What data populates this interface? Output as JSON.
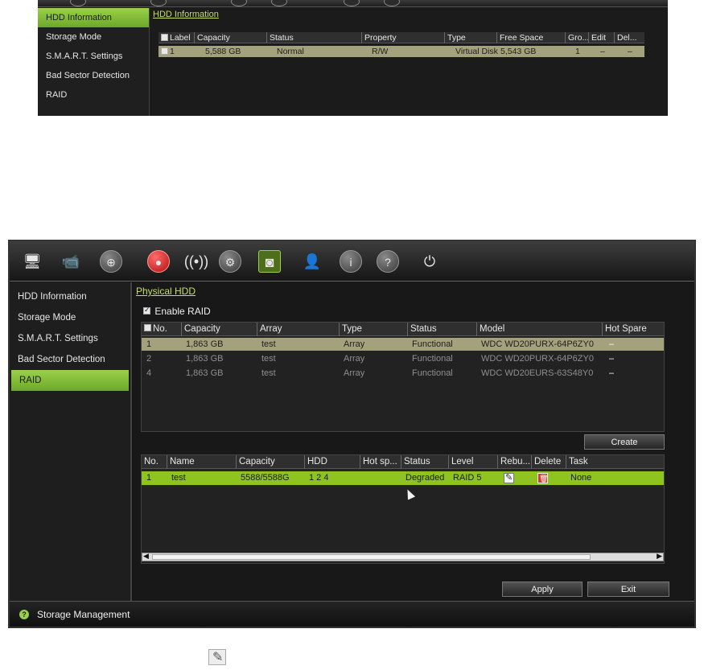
{
  "screen1": {
    "sidebar": [
      "HDD Information",
      "Storage Mode",
      "S.M.A.R.T. Settings",
      "Bad Sector Detection",
      "RAID"
    ],
    "active_index": 0,
    "tab_title": "HDD Information",
    "table": {
      "headers": [
        "Label",
        "Capacity",
        "Status",
        "Property",
        "Type",
        "Free Space",
        "Gro...",
        "Edit",
        "Del..."
      ],
      "rows": [
        {
          "label": "1",
          "capacity": "5,588 GB",
          "status": "Normal",
          "property": "R/W",
          "type": "Virtual Disk",
          "free": "5,543 GB",
          "group": "1",
          "edit": "–",
          "delete": "–"
        }
      ]
    }
  },
  "screen2": {
    "toolbar_icons": [
      "display-icon",
      "camera-icon",
      "network-icon",
      "record-icon",
      "alarm-icon",
      "device-icon",
      "hdd-icon",
      "user-icon",
      "info-icon",
      "help-icon",
      "power-icon"
    ],
    "sidebar": [
      "HDD Information",
      "Storage Mode",
      "S.M.A.R.T. Settings",
      "Bad Sector Detection",
      "RAID"
    ],
    "active_index": 4,
    "tab_title": "Physical HDD",
    "enable_raid_label": "Enable RAID",
    "hdd_table": {
      "headers": [
        "No.",
        "Capacity",
        "Array",
        "Type",
        "Status",
        "Model",
        "Hot Spare"
      ],
      "rows": [
        {
          "no": "1",
          "capacity": "1,863 GB",
          "array": "test",
          "type": "Array",
          "status": "Functional",
          "model": "WDC WD20PURX-64P6ZY0",
          "hot": "–"
        },
        {
          "no": "2",
          "capacity": "1,863 GB",
          "array": "test",
          "type": "Array",
          "status": "Functional",
          "model": "WDC WD20PURX-64P6ZY0",
          "hot": "–"
        },
        {
          "no": "4",
          "capacity": "1,863 GB",
          "array": "test",
          "type": "Array",
          "status": "Functional",
          "model": "WDC WD20EURS-63S48Y0",
          "hot": "–"
        }
      ]
    },
    "create_button": "Create",
    "array_table": {
      "headers": [
        "No.",
        "Name",
        "Capacity",
        "HDD",
        "Hot sp...",
        "Status",
        "Level",
        "Rebu...",
        "Delete",
        "Task"
      ],
      "rows": [
        {
          "no": "1",
          "name": "test",
          "capacity": "5588/5588G",
          "hdd": "1  2  4",
          "hot": "",
          "status": "Degraded",
          "level": "RAID 5",
          "task": "None"
        }
      ]
    },
    "apply_button": "Apply",
    "exit_button": "Exit",
    "status_bar": "Storage Management",
    "colors": {
      "accent": "#9bd14a",
      "selected_row": "#a3a27c",
      "active_row": "#8fc31f"
    }
  }
}
